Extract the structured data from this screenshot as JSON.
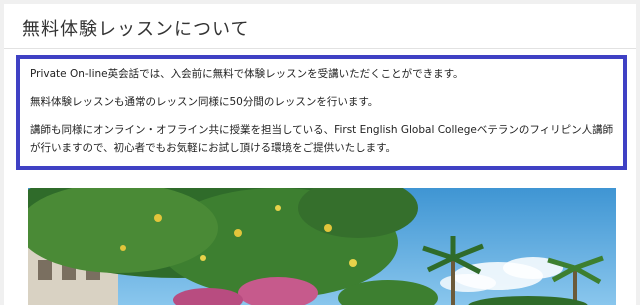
{
  "page": {
    "title": "無料体験レッスンについて"
  },
  "info": {
    "paragraphs": [
      "Private On-line英会話では、入会前に無料で体験レッスンを受講いただくことができます。",
      "無料体験レッスンも通常のレッスン同様に50分間のレッスンを行います。",
      "講師も同様にオンライン・オフライン共に授業を担当している、First English Global Collegeベテランのフィリピン人講師が行いますので、初心者でもお気軽にお試し頂ける環境をご提供いたします。"
    ]
  },
  "colors": {
    "box_border": "#3f41c4",
    "sky": "#5aa6d9",
    "foliage": "#2f6b2a"
  }
}
